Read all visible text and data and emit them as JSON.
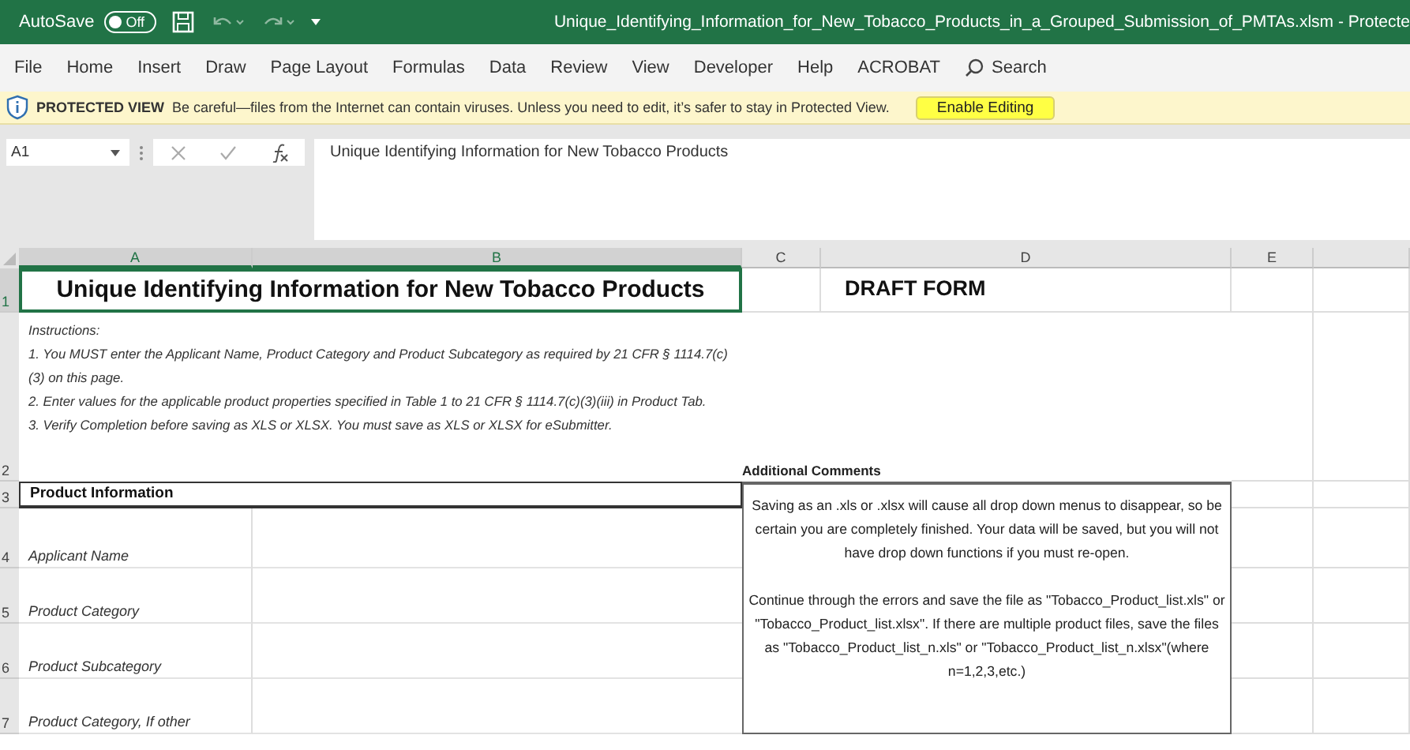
{
  "title_bar": {
    "autosave_label": "AutoSave",
    "autosave_state": "Off",
    "autosave_on": false,
    "title": "Unique_Identifying_Information_for_New_Tobacco_Products_in_a_Grouped_Submission_of_PMTAs.xlsm  -  Protecte"
  },
  "menu": [
    {
      "label": "File"
    },
    {
      "label": "Home"
    },
    {
      "label": "Insert"
    },
    {
      "label": "Draw"
    },
    {
      "label": "Page Layout"
    },
    {
      "label": "Formulas"
    },
    {
      "label": "Data"
    },
    {
      "label": "Review"
    },
    {
      "label": "View"
    },
    {
      "label": "Developer"
    },
    {
      "label": "Help"
    },
    {
      "label": "ACROBAT"
    }
  ],
  "search": {
    "placeholder": "Search"
  },
  "protected_view": {
    "label": "PROTECTED VIEW",
    "message": "Be careful—files from the Internet can contain viruses. Unless you need to edit, it’s safer to stay in Protected View.",
    "button": "Enable Editing"
  },
  "formula_bar": {
    "name_box": "A1",
    "formula": "Unique Identifying Information for New Tobacco Products"
  },
  "sheet": {
    "columns": [
      {
        "label": "A",
        "selected": true
      },
      {
        "label": "B",
        "selected": true
      },
      {
        "label": "C",
        "selected": false
      },
      {
        "label": "D",
        "selected": false
      },
      {
        "label": "E",
        "selected": false
      }
    ],
    "rows": [
      {
        "label": "1",
        "selected": true
      },
      {
        "label": "2",
        "selected": false
      },
      {
        "label": "3",
        "selected": false
      },
      {
        "label": "4",
        "selected": false
      },
      {
        "label": "5",
        "selected": false
      },
      {
        "label": "6",
        "selected": false
      },
      {
        "label": "7",
        "selected": false
      }
    ],
    "title": "Unique Identifying Information for New Tobacco Products",
    "draft_label": "DRAFT FORM",
    "instructions": [
      "Instructions:",
      "1.  You MUST enter the Applicant Name, Product Category and Product Subcategory as required by 21 CFR § 1114.7(c)(3) on this page.",
      "2.  Enter values for the applicable product properties specified in Table 1 to 21 CFR § 1114.7(c)(3)(iii) in Product Tab.",
      "3.  Verify Completion before saving as XLS or XLSX.  You must save as XLS or XLSX for eSubmitter."
    ],
    "section_header": "Product Information",
    "fields": [
      {
        "label": "Applicant Name"
      },
      {
        "label": "Product Category"
      },
      {
        "label": "Product Subcategory"
      },
      {
        "label": "Product Category, If other"
      }
    ],
    "comments_label": "Additional Comments",
    "comments": [
      "Saving as an .xls or .xlsx will cause all drop down menus to disappear, so be certain you are completely finished.  Your data will be saved, but you will not have drop down functions if you must re-open.",
      "Continue through the errors and save the file as \"Tobacco_Product_list.xls\" or \"Tobacco_Product_list.xlsx\". If there are multiple product files, save the files as \"Tobacco_Product_list_n.xls\"  or \"Tobacco_Product_list_n.xlsx\"(where n=1,2,3,etc.)"
    ]
  }
}
